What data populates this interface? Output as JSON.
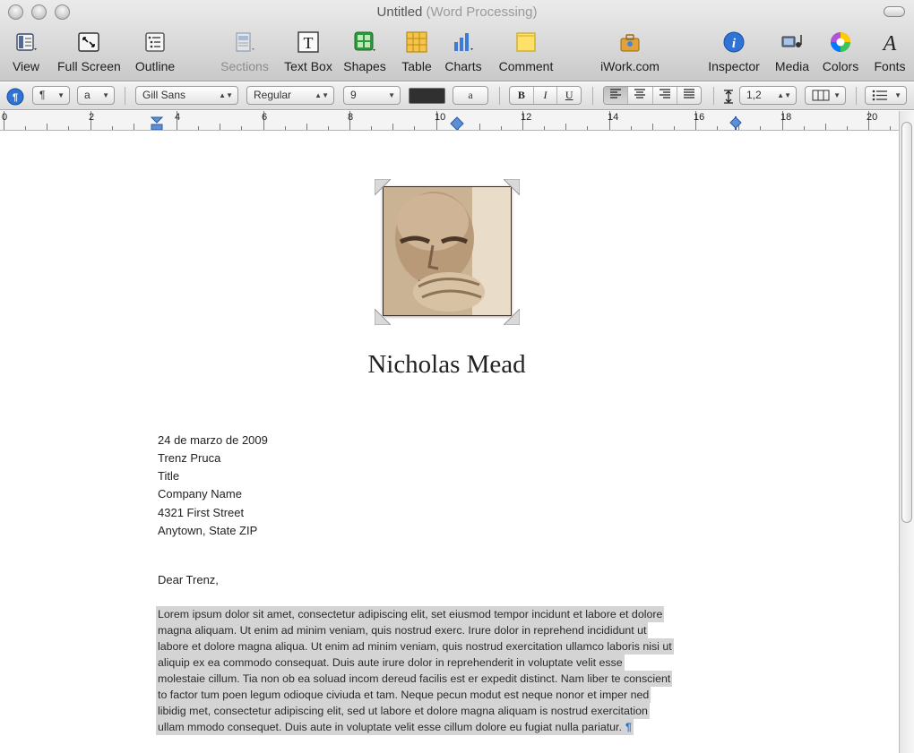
{
  "window": {
    "title": "Untitled",
    "subtitle": "(Word Processing)"
  },
  "toolbar": [
    {
      "id": "view",
      "label": "View",
      "icon": "view-icon"
    },
    {
      "id": "fullscreen",
      "label": "Full Screen",
      "icon": "full-screen-icon"
    },
    {
      "id": "outline",
      "label": "Outline",
      "icon": "outline-icon"
    },
    {
      "id": "sections",
      "label": "Sections",
      "icon": "sections-icon",
      "disabled": true
    },
    {
      "id": "textbox",
      "label": "Text Box",
      "icon": "text-box-icon"
    },
    {
      "id": "shapes",
      "label": "Shapes",
      "icon": "shapes-icon"
    },
    {
      "id": "table",
      "label": "Table",
      "icon": "table-icon"
    },
    {
      "id": "charts",
      "label": "Charts",
      "icon": "charts-icon"
    },
    {
      "id": "comment",
      "label": "Comment",
      "icon": "comment-icon"
    },
    {
      "id": "iwork",
      "label": "iWork.com",
      "icon": "iwork-icon"
    },
    {
      "id": "inspector",
      "label": "Inspector",
      "icon": "inspector-icon"
    },
    {
      "id": "media",
      "label": "Media",
      "icon": "media-icon"
    },
    {
      "id": "colors",
      "label": "Colors",
      "icon": "colors-icon"
    },
    {
      "id": "fonts",
      "label": "Fonts",
      "icon": "fonts-icon"
    }
  ],
  "formatbar": {
    "paragraph_style": "¶",
    "char_style": "a",
    "font_family": "Gill Sans",
    "font_typeface": "Regular",
    "font_size": "9",
    "highlight_sample": "a",
    "bold": "B",
    "italic": "I",
    "underline": "U",
    "line_spacing": "1,2"
  },
  "ruler": {
    "labels": [
      "0",
      "2",
      "4",
      "6",
      "8",
      "10",
      "12",
      "14",
      "16",
      "18",
      "20"
    ]
  },
  "document": {
    "author_name": "Nicholas Mead",
    "address_lines": [
      "24 de marzo de 2009",
      "Trenz Pruca",
      "Title",
      "Company Name",
      "4321 First Street",
      "Anytown, State ZIP"
    ],
    "salutation": "Dear Trenz,",
    "body_lines": [
      "Lorem ipsum dolor sit amet, consectetur adipiscing elit, set eiusmod tempor incidunt et labore et dolore",
      "magna aliquam. Ut enim ad minim veniam, quis nostrud exerc. Irure dolor in reprehend incididunt ut",
      "labore et dolore magna aliqua. Ut enim ad minim veniam, quis nostrud exercitation ullamco laboris nisi ut",
      "aliquip ex ea commodo consequat. Duis aute irure dolor in reprehenderit in voluptate velit esse",
      "molestaie cillum. Tia non ob ea soluad incom dereud facilis est er expedit distinct. Nam liber te conscient",
      "to factor tum poen legum odioque civiuda et tam. Neque pecun modut est neque nonor et imper ned",
      "libidig met, consectetur adipiscing elit, sed ut labore et dolore magna aliquam is nostrud exercitation",
      "ullam mmodo consequet. Duis aute in voluptate velit esse cillum dolore eu fugiat nulla pariatur."
    ],
    "pilcrow": "¶"
  },
  "colors": {
    "selection": "#d4d4d4",
    "accent_blue": "#1f6fd0"
  }
}
